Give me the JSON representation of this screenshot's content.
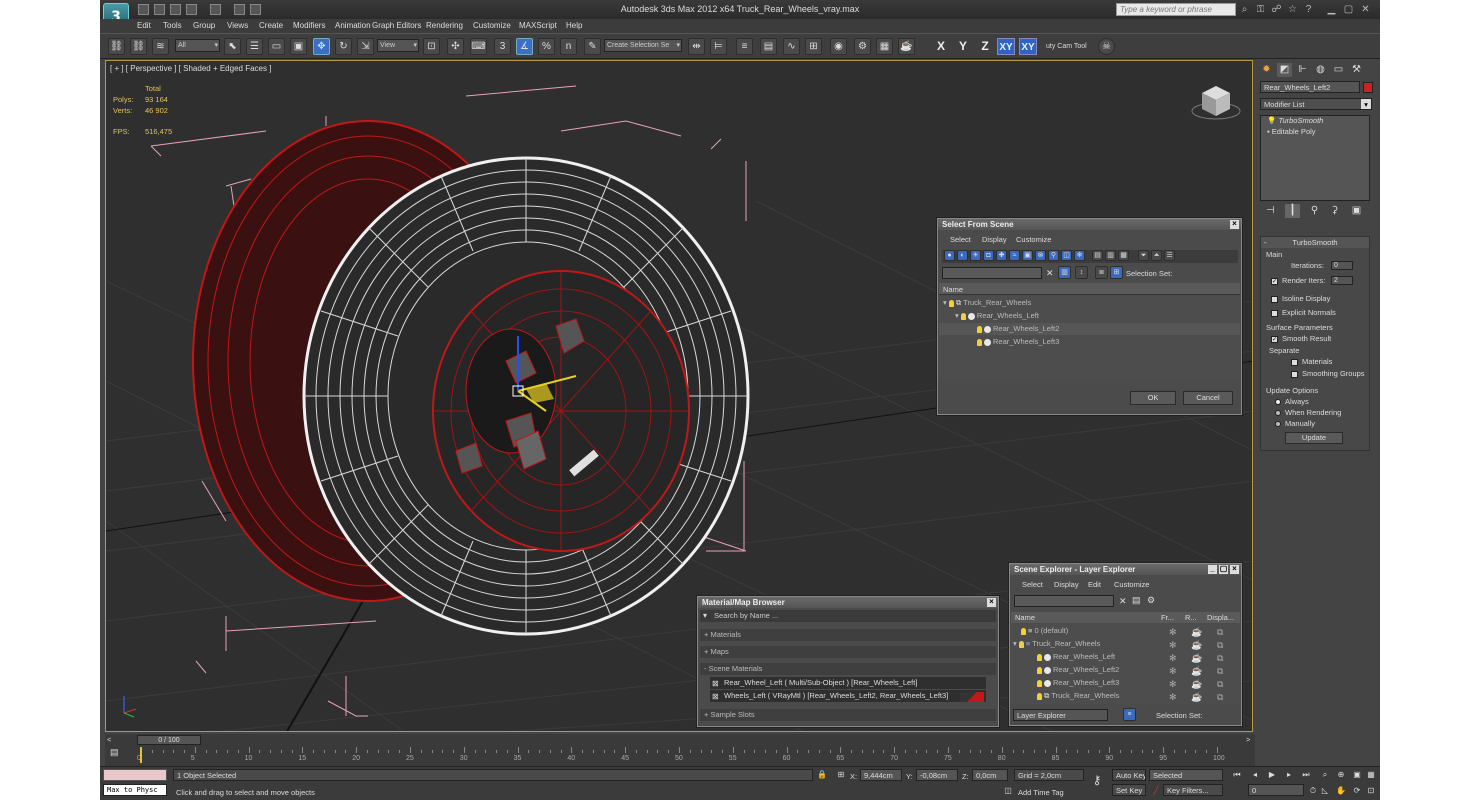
{
  "window": {
    "title": "Autodesk 3ds Max  2012 x64     Truck_Rear_Wheels_vray.max",
    "search_placeholder": "Type a keyword or phrase",
    "logo": "3"
  },
  "menu": [
    "Edit",
    "Tools",
    "Group",
    "Views",
    "Create",
    "Modifiers",
    "Animation",
    "Graph Editors",
    "Rendering",
    "Customize",
    "MAXScript",
    "Help"
  ],
  "toolbar": {
    "filter": "All",
    "refcoord": "View",
    "selset": "Create Selection Se",
    "snap": "3",
    "angle": "%",
    "n": "n",
    "axes": [
      "X",
      "Y",
      "Z",
      "XY",
      "XY"
    ],
    "util": "uty Cam Tool"
  },
  "viewport": {
    "label": "[ + ] [ Perspective ] [ Shaded + Edged Faces ]",
    "stats": {
      "total": "Total",
      "polys_label": "Polys:",
      "polys": "93 164",
      "verts_label": "Verts:",
      "verts": "46 902",
      "fps_label": "FPS:",
      "fps": "516,475"
    }
  },
  "select_from_scene": {
    "title": "Select From Scene",
    "menu": [
      "Select",
      "Display",
      "Customize"
    ],
    "selection_set": "Selection Set:",
    "col_name": "Name",
    "rows": [
      "Truck_Rear_Wheels",
      "Rear_Wheels_Left",
      "Rear_Wheels_Left2",
      "Rear_Wheels_Left3"
    ],
    "ok": "OK",
    "cancel": "Cancel"
  },
  "scene_explorer": {
    "title": "Scene Explorer - Layer Explorer",
    "menu": [
      "Select",
      "Display",
      "Edit",
      "Customize"
    ],
    "cols": [
      "Name",
      "Fr...",
      "R...",
      "Displa..."
    ],
    "rows": [
      "0 (default)",
      "Truck_Rear_Wheels",
      "Rear_Wheels_Left",
      "Rear_Wheels_Left2",
      "Rear_Wheels_Left3",
      "Truck_Rear_Wheels"
    ],
    "layer_explorer": "Layer Explorer",
    "selection_set": "Selection Set:"
  },
  "material_browser": {
    "title": "Material/Map Browser",
    "search": "Search by Name ...",
    "groups": [
      "+ Materials",
      "+ Maps",
      "- Scene Materials"
    ],
    "items": [
      "Rear_Wheel_Left  ( Multi/Sub-Object )  [Rear_Wheels_Left]",
      "Wheels_Left  ( VRayMtl )  [Rear_Wheels_Left2, Rear_Wheels_Left3]"
    ],
    "sample": "+ Sample Slots"
  },
  "command_panel": {
    "object_name": "Rear_Wheels_Left2",
    "object_color": "#cc2222",
    "modifier_list": "Modifier List",
    "stack": [
      "TurboSmooth",
      "Editable Poly"
    ],
    "turbosmooth": {
      "header": "TurboSmooth",
      "main": "Main",
      "iterations_label": "Iterations:",
      "iterations": "0",
      "render_iters_label": "Render Iters:",
      "render_iters": "2",
      "isoline": "Isoline Display",
      "explicit": "Explicit Normals",
      "surface": "Surface Parameters",
      "smooth_result": "Smooth Result",
      "separate": "Separate",
      "materials": "Materials",
      "smoothing": "Smoothing Groups",
      "update_options": "Update Options",
      "always": "Always",
      "when_rendering": "When Rendering",
      "manually": "Manually",
      "update": "Update"
    }
  },
  "timeline": {
    "frame": "0 / 100",
    "ticks": [
      "0",
      "5",
      "10",
      "15",
      "20",
      "25",
      "30",
      "35",
      "40",
      "45",
      "50",
      "55",
      "60",
      "65",
      "70",
      "75",
      "80",
      "85",
      "90",
      "95",
      "100"
    ]
  },
  "status": {
    "script": "Max to Physc",
    "selected": "1 Object Selected",
    "hint": "Click and drag to select and move objects",
    "x_label": "X:",
    "x": "9,444cm",
    "y_label": "Y:",
    "y": "-0,08cm",
    "z_label": "Z:",
    "z": "0,0cm",
    "grid": "Grid = 2,0cm",
    "add_time_tag": "Add Time Tag",
    "auto_key": "Auto Key",
    "set_key": "Set Key",
    "selected_dd": "Selected",
    "key_filters": "Key Filters...",
    "frame": "0"
  },
  "colors": {
    "accent": "#3b6fc7",
    "viewport_border": "#b89a45",
    "stats": "#e2c25a",
    "wire_red": "#c01818"
  }
}
